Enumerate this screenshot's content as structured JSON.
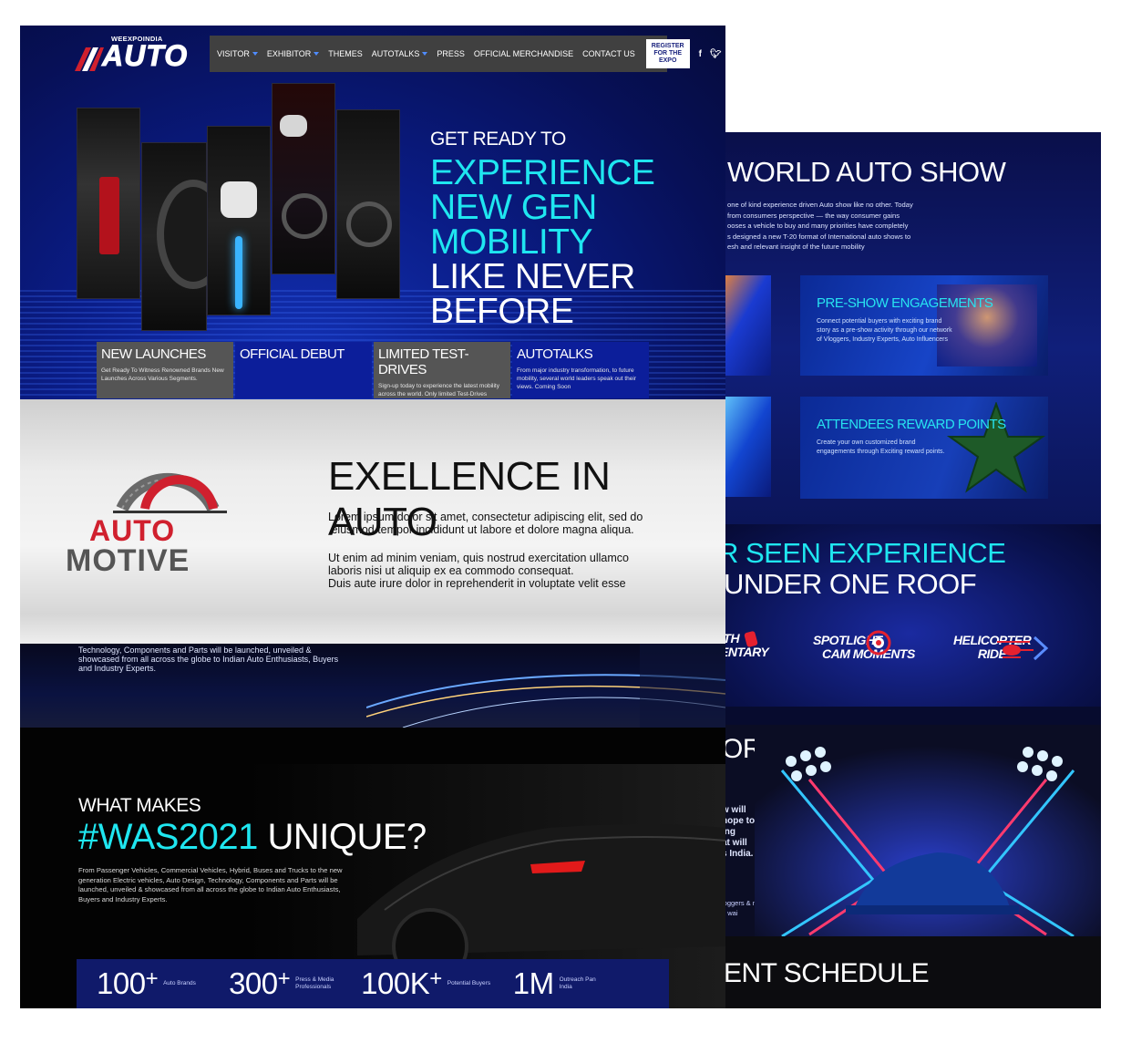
{
  "brand": {
    "top_word": "WEEXPOINDIA",
    "logo_word": "AUTO"
  },
  "nav": {
    "items": [
      {
        "label": "VISITOR",
        "dropdown": true
      },
      {
        "label": "EXHIBITOR",
        "dropdown": true
      },
      {
        "label": "THEMES",
        "dropdown": false
      },
      {
        "label": "AUTOTALKS",
        "dropdown": true
      },
      {
        "label": "PRESS",
        "dropdown": false
      },
      {
        "label": "OFFICIAL MERCHANDISE",
        "dropdown": false
      },
      {
        "label": "CONTACT US",
        "dropdown": false
      }
    ],
    "register_label_1": "REGISTER",
    "register_label_2": "FOR THE EXPO",
    "social": [
      "facebook-icon",
      "twitter-icon",
      "linkedin-icon",
      "youtube-icon"
    ]
  },
  "hero": {
    "pre": "GET READY TO",
    "line1": "EXPERIENCE",
    "line2": "NEW GEN MOBILITY",
    "line3": "LIKE NEVER BEFORE"
  },
  "features": [
    {
      "title": "NEW LAUNCHES",
      "text": "Get Ready To Witness Renowned Brands New Launches Across Various Segments."
    },
    {
      "title": "OFFICIAL DEBUT",
      "text": ""
    },
    {
      "title": "LIMITED TEST-DRIVES",
      "text": "Sign-up today to experience the latest mobility across the world. Only limited Test-Drives available."
    },
    {
      "title": "AUTOTALKS",
      "text": "From major industry transformation, to future mobility, several world leaders speak out their views. Coming Soon"
    }
  ],
  "excellence": {
    "title": "EXELLENCE IN AUTO",
    "logo_line1": "AUTO",
    "logo_line2": "MOTIVE",
    "para1_line1": "Lorem ipsum dolor sit amet, consectetur adipiscing elit, sed do",
    "para1_line2": " eiusmod tempor incididunt ut labore et dolore magna aliqua.",
    "para2_line1": "Ut enim ad minim veniam, quis nostrud exercitation ullamco",
    "para2_line2": "laboris nisi ut aliquip ex ea commodo consequat.",
    "para2_line3": "Duis aute irure dolor in reprehenderit in voluptate velit esse"
  },
  "city": {
    "text": "Technology, Components and Parts will be launched, unveiled & showcased from all across the globe to Indian Auto Enthusiasts, Buyers and Industry Experts."
  },
  "unique": {
    "pre": "WHAT MAKES",
    "hash": "#WAS2021",
    "rest": " UNIQUE?",
    "desc": "From Passenger Vehicles, Commercial Vehicles, Hybrid, Buses and Trucks to the new generation Electric vehicles, Auto Design, Technology, Components and Parts will be launched, unveiled & showcased from all across the globe to Indian Auto Enthusiasts, Buyers and Industry Experts."
  },
  "stats": [
    {
      "number": "100",
      "label": "Auto Brands"
    },
    {
      "number": "300",
      "label": "Press & Media Professionals"
    },
    {
      "number": "100K",
      "label": "Potential Buyers"
    },
    {
      "number": "1M",
      "label": "Outreach Pan India"
    }
  ],
  "back": {
    "show_title": "WORLD AUTO SHOW",
    "show_text_1": "one of kind experience driven Auto show like no other. Today",
    "show_text_2": "from consumers perspective — the way consumer gains",
    "show_text_3": "ooses a vehicle to buy and many priorities have completely",
    "show_text_4": "s designed a new T-20 format of International auto shows to",
    "show_text_5": "esh and relevant insight of the future mobility",
    "card1_title": "PRE-SHOW ENGAGEMENTS",
    "card1_text": "Connect potential buyers with exciting brand story as a pre-show activity through our network of Vloggers, Industry Experts, Auto Influencers",
    "card2_title": "ATTENDEES REWARD POINTS",
    "card2_text": "Create your own customized brand engagements through Exciting reward points.",
    "exp_line1": "R SEEN EXPERIENCE",
    "exp_line2": "UNDER ONE ROOF",
    "exp_items": [
      {
        "line1": "ITH",
        "line2": "ENTARY"
      },
      {
        "line1": "SPOTLIGHT",
        "line2": "CAM MOMENTS"
      },
      {
        "line1": "HELICOPTER",
        "line2": "RIDE"
      }
    ],
    "or_title": "OR",
    "or_text": [
      "w will",
      "hope to",
      "ing",
      "at will",
      "s India."
    ],
    "or_text2": [
      "loggers & more",
      "o wai"
    ],
    "schedule_title": "ENT SCHEDULE"
  },
  "colors": {
    "accent": "#1fe6f0",
    "navy": "#0a1c86",
    "brand_red": "#d0202e"
  }
}
